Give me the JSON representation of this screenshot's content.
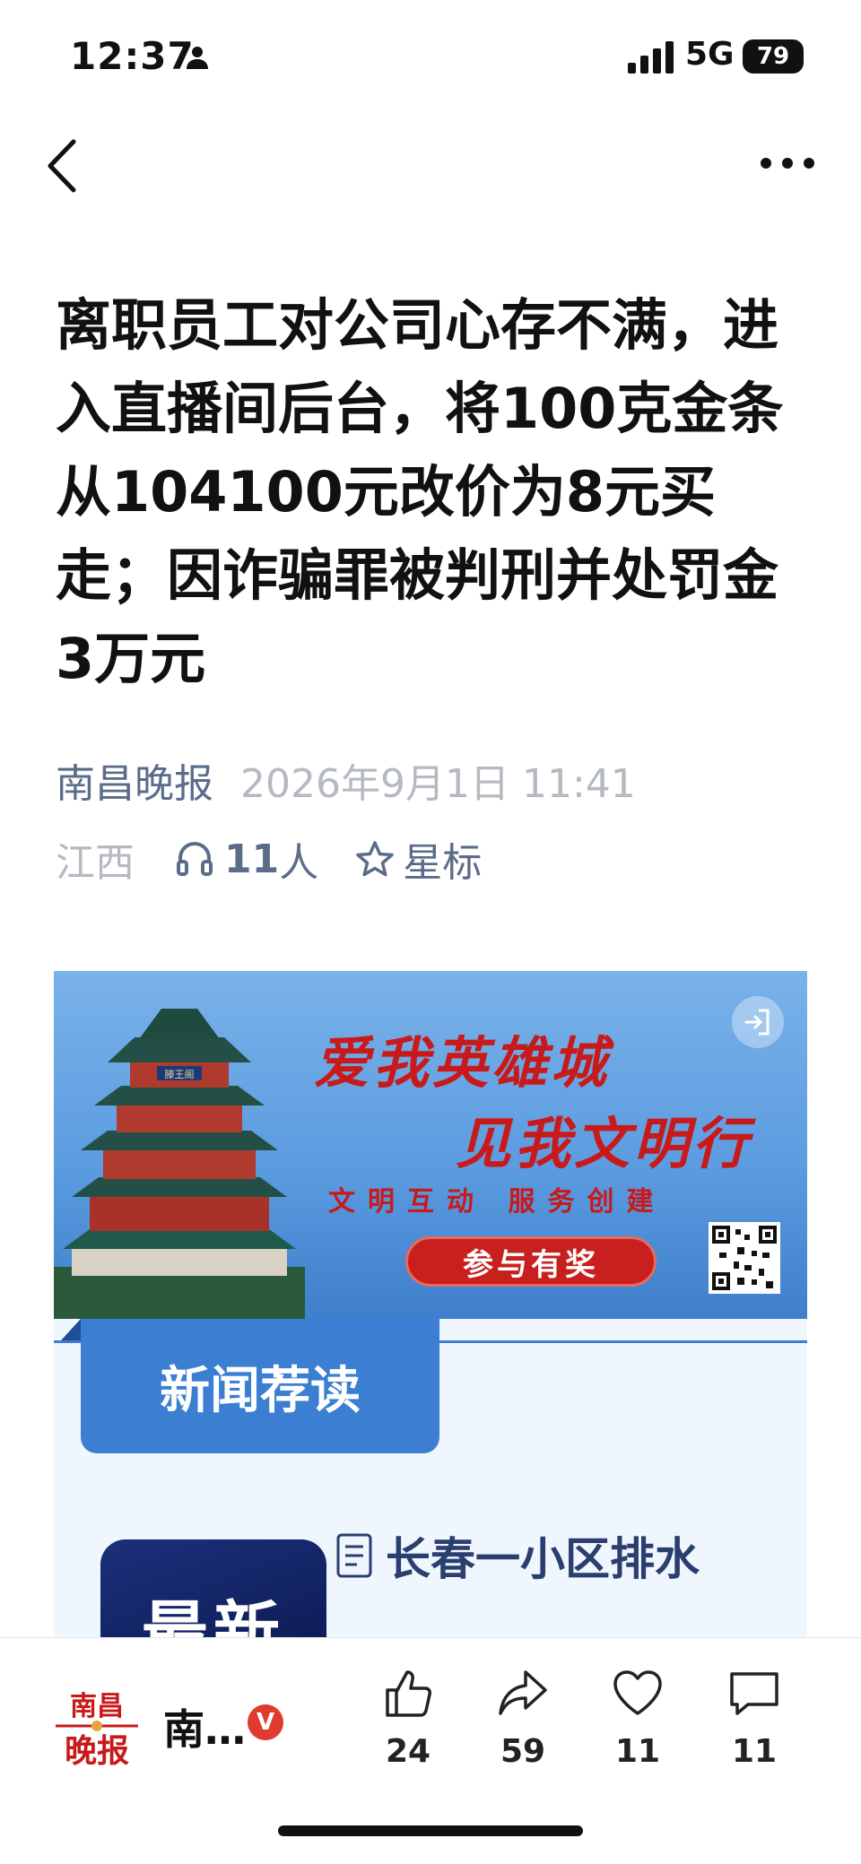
{
  "status_bar": {
    "time": "12:37",
    "network": "5G",
    "battery": "79"
  },
  "article": {
    "headline": "离职员工对公司心存不满，进入直播间后台，将100克金条从104100元改价为8元买走；因诈骗罪被判刑并处罚金3万元",
    "source": "南昌晚报",
    "date": "2026年9月1日 11:41",
    "region": "江西",
    "listeners": "11",
    "listeners_unit": "人",
    "star_label": "星标"
  },
  "banner": {
    "slogan_line1": "爱我英雄城",
    "slogan_line2": "见我文明行",
    "slogan_line3": "文明互动 服务创建",
    "button": "参与有奖",
    "tower_plaque": "滕王阁"
  },
  "recommend": {
    "tab_label": "新闻荐读",
    "thumb_text": "最新",
    "item_title": "长春一小区排水"
  },
  "bottom_bar": {
    "logo_top": "南昌",
    "logo_bottom": "晚报",
    "source_name": "南…",
    "verified_badge": "V",
    "actions": [
      {
        "icon": "thumbs-up-icon",
        "count": "24"
      },
      {
        "icon": "share-icon",
        "count": "59"
      },
      {
        "icon": "heart-icon",
        "count": "11"
      },
      {
        "icon": "comment-icon",
        "count": "11"
      }
    ]
  }
}
